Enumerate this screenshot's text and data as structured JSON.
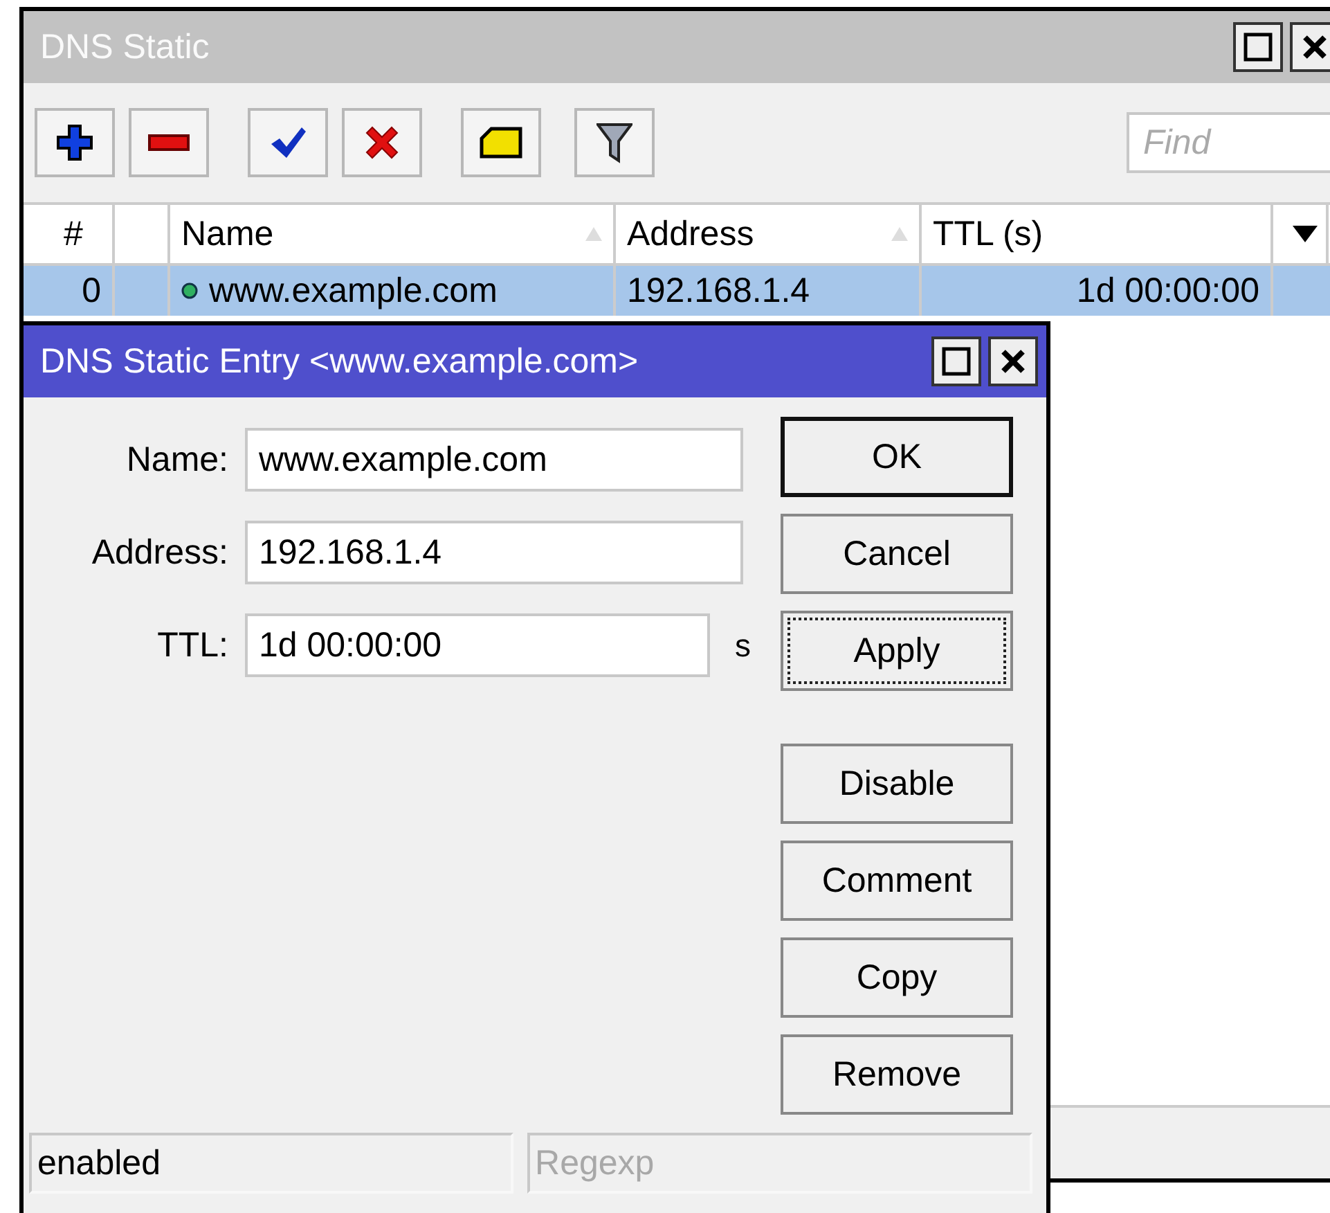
{
  "window": {
    "title": "DNS Static"
  },
  "toolbar": [
    {
      "kind": "add"
    },
    {
      "kind": "remove"
    },
    {
      "kind": "enable"
    },
    {
      "kind": "disable"
    },
    {
      "kind": "comment"
    },
    {
      "kind": "filter"
    }
  ],
  "search": {
    "placeholder": "Find"
  },
  "table": {
    "columns": [
      {
        "label": "#",
        "sort_indicator": false
      },
      {
        "label": "Name",
        "sort_indicator": true
      },
      {
        "label": "Address",
        "sort_indicator": true
      },
      {
        "label": "TTL (s)",
        "sort_indicator": false
      }
    ],
    "rows": [
      {
        "index": "0",
        "name": "www.example.com",
        "address": "192.168.1.4",
        "ttl": "1d 00:00:00",
        "selected": true
      }
    ]
  },
  "dialog": {
    "title": "DNS Static Entry <www.example.com>",
    "fields": [
      {
        "label": "Name:",
        "value": "www.example.com"
      },
      {
        "label": "Address:",
        "value": "192.168.1.4"
      },
      {
        "label": "TTL:",
        "value": "1d 00:00:00",
        "unit": "s"
      }
    ],
    "buttons": [
      {
        "label": "OK",
        "default": true,
        "focused": false
      },
      {
        "label": "Cancel",
        "default": false,
        "focused": false
      },
      {
        "label": "Apply",
        "default": false,
        "focused": true
      },
      {
        "label": "Disable",
        "default": false,
        "focused": false
      },
      {
        "label": "Comment",
        "default": false,
        "focused": false
      },
      {
        "label": "Copy",
        "default": false,
        "focused": false
      },
      {
        "label": "Remove",
        "default": false,
        "focused": false
      }
    ],
    "status": {
      "text": "enabled",
      "regexp": {
        "placeholder": "Regexp",
        "disabled": true
      }
    }
  }
}
